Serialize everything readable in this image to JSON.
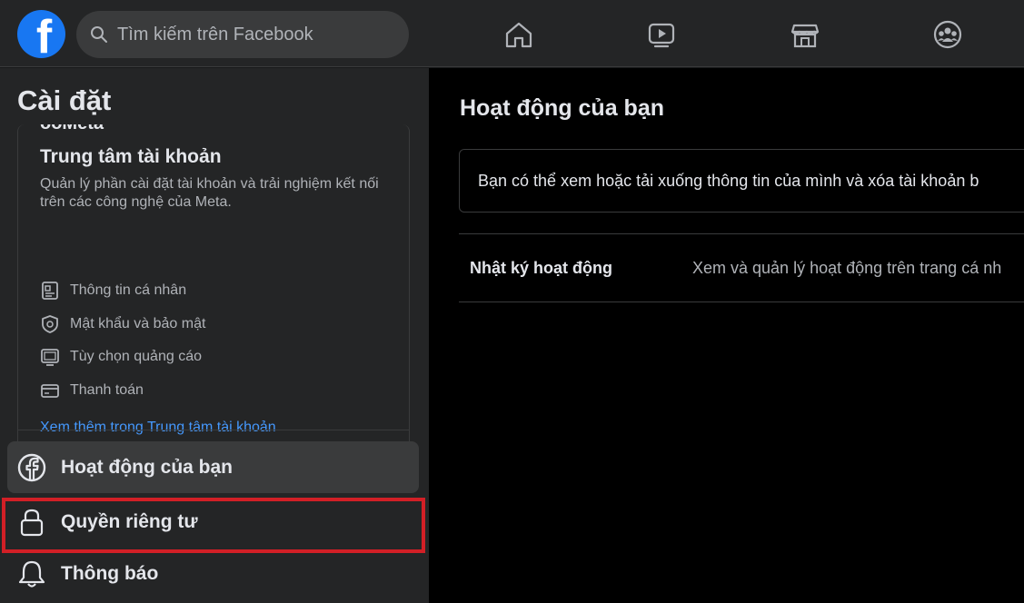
{
  "header": {
    "logo_letter": "f",
    "search_placeholder": "Tìm kiếm trên Facebook",
    "nav_icons": [
      "home-icon",
      "video-icon",
      "marketplace-icon",
      "groups-icon"
    ]
  },
  "sidebar": {
    "title": "Cài đặt",
    "account_center": {
      "cut_off_text": "ooMeta",
      "title": "Trung tâm tài khoản",
      "description": "Quản lý phần cài đặt tài khoản và trải nghiệm kết nối trên các công nghệ của Meta.",
      "items": [
        {
          "label": "Thông tin cá nhân",
          "icon": "id-card-icon"
        },
        {
          "label": "Mật khẩu và bảo mật",
          "icon": "shield-icon"
        },
        {
          "label": "Tùy chọn quảng cáo",
          "icon": "monitor-icon"
        },
        {
          "label": "Thanh toán",
          "icon": "credit-card-icon"
        }
      ],
      "see_more": "Xem thêm trong Trung tâm tài khoản"
    },
    "menu": [
      {
        "label": "Hoạt động của bạn",
        "icon": "facebook-icon",
        "active": true
      },
      {
        "label": "Quyền riêng tư",
        "icon": "lock-icon",
        "highlighted": true
      },
      {
        "label": "Thông báo",
        "icon": "bell-icon"
      }
    ]
  },
  "main": {
    "title": "Hoạt động của bạn",
    "info_text": "Bạn có thể xem hoặc tải xuống thông tin của mình và xóa tài khoản b",
    "activity_log": {
      "label": "Nhật ký hoạt động",
      "description": "Xem và quản lý hoạt động trên trang cá nh"
    }
  },
  "colors": {
    "brand": "#1877f2",
    "highlight": "#d21f26",
    "link": "#4599ff"
  }
}
